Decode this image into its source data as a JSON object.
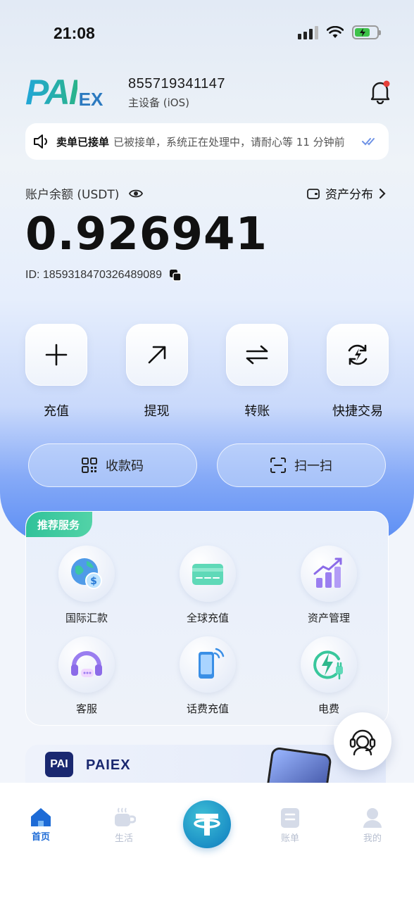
{
  "status_bar": {
    "time": "21:08"
  },
  "header": {
    "logo_main": "PAI",
    "logo_sub": "EX",
    "account_number": "855719341147",
    "device_label": "主设备 (iOS)"
  },
  "notice": {
    "title": "卖单已接单",
    "message": "已被接单，系统正在处理中，请耐心等 11 分钟前"
  },
  "balance": {
    "label": "账户余额 (USDT)",
    "asset_link": "资产分布",
    "amount": "0.926941",
    "user_id": "ID: 1859318470326489089"
  },
  "quick_actions": [
    {
      "label": "充值",
      "icon": "plus-icon"
    },
    {
      "label": "提现",
      "icon": "arrow-up-right-icon"
    },
    {
      "label": "转账",
      "icon": "swap-arrows-icon"
    },
    {
      "label": "快捷交易",
      "icon": "quick-exchange-icon"
    }
  ],
  "pills": {
    "receive": "收款码",
    "scan": "扫一扫"
  },
  "services": {
    "tag": "推荐服务",
    "items": [
      {
        "label": "国际汇款",
        "icon": "globe-money-icon"
      },
      {
        "label": "全球充值",
        "icon": "card-icon"
      },
      {
        "label": "资产管理",
        "icon": "chart-growth-icon"
      },
      {
        "label": "客服",
        "icon": "headset-icon"
      },
      {
        "label": "话费充值",
        "icon": "phone-signal-icon"
      },
      {
        "label": "电费",
        "icon": "power-plug-icon"
      }
    ]
  },
  "banner": {
    "logo_text": "PAI",
    "brand": "PAIEX"
  },
  "tabbar": {
    "home": "首页",
    "life": "生活",
    "bills": "账单",
    "me": "我的"
  },
  "colors": {
    "accent_blue": "#1d6bd6",
    "tag_green": "#31c29a",
    "battery_green": "#3ec24a",
    "bell_red": "#e6403a"
  }
}
